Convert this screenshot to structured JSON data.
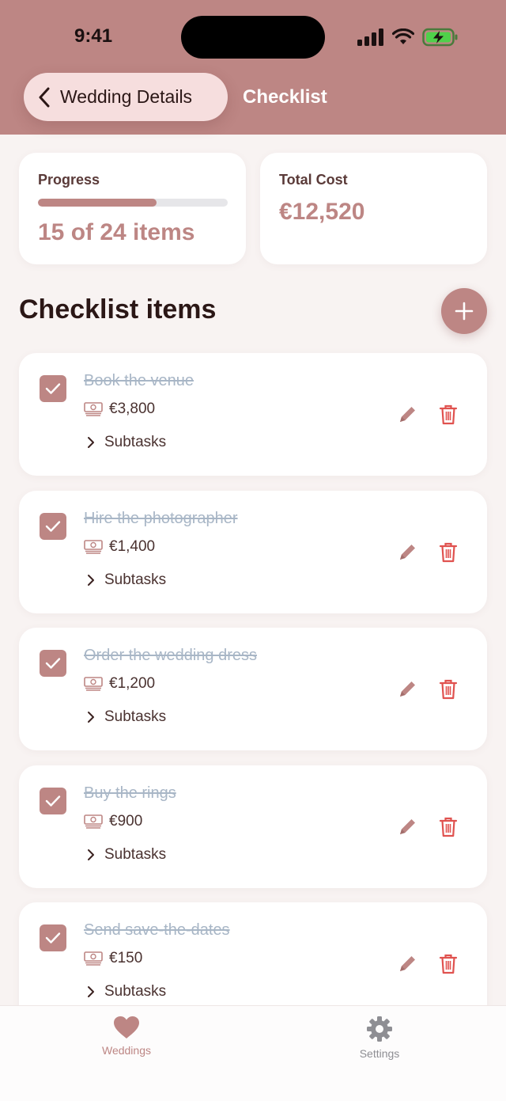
{
  "status_bar": {
    "time": "9:41"
  },
  "nav": {
    "back_label": "Wedding Details",
    "title": "Checklist"
  },
  "summary": {
    "progress_label": "Progress",
    "progress_fraction": 0.625,
    "progress_text": "15 of 24 items",
    "cost_label": "Total Cost",
    "cost_value": "€12,520"
  },
  "section": {
    "title": "Checklist items"
  },
  "items": [
    {
      "title": "Book the venue",
      "cost": "€3,800",
      "subtasks_label": "Subtasks",
      "done": true
    },
    {
      "title": "Hire the photographer",
      "cost": "€1,400",
      "subtasks_label": "Subtasks",
      "done": true
    },
    {
      "title": "Order the wedding dress",
      "cost": "€1,200",
      "subtasks_label": "Subtasks",
      "done": true
    },
    {
      "title": "Buy the rings",
      "cost": "€900",
      "subtasks_label": "Subtasks",
      "done": true
    },
    {
      "title": "Send save-the-dates",
      "cost": "€150",
      "subtasks_label": "Subtasks",
      "done": true
    }
  ],
  "tabs": [
    {
      "label": "Weddings",
      "icon": "heart-icon",
      "active": true
    },
    {
      "label": "Settings",
      "icon": "gear-icon",
      "active": false
    }
  ],
  "colors": {
    "accent": "#bd8684",
    "danger": "#e0524f",
    "completed_text": "#a8b6c6",
    "tab_inactive": "#8e8e93"
  }
}
